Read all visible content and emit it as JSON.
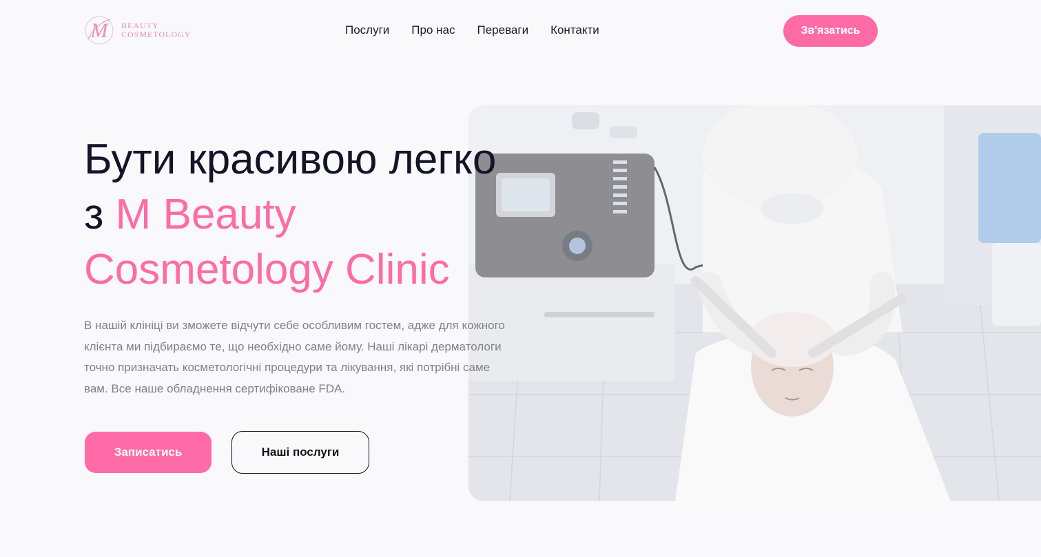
{
  "header": {
    "logo": {
      "line1": "BEAUTY",
      "line2": "COSMETOLOGY",
      "monogram": "M"
    },
    "nav": [
      {
        "label": "Послуги"
      },
      {
        "label": "Про нас"
      },
      {
        "label": "Переваги"
      },
      {
        "label": "Контакти"
      }
    ],
    "contact_button": "Зв'язатись"
  },
  "hero": {
    "title_line1": "Бути красивою легко",
    "title_prefix": "з ",
    "title_brand_line1": "M Beauty",
    "title_brand_line2": "Cosmetology Clinic",
    "description": "В нашій клініці ви зможете відчути себе особливим гостем, адже для кожного клієнта ми підбираємо те, що необхідно саме йому. Наші лікарі дерматологи точно призначать косметологічні процедури та лікування, які потрібні саме вам. Все наше обладнення сертифіковане FDA.",
    "primary_button": "Записатись",
    "secondary_button": "Наші послуги"
  },
  "colors": {
    "accent": "#ff6ba6",
    "text_dark": "#141428",
    "text_muted": "#80808f",
    "background": "#f9f9fb"
  },
  "icons": {
    "logo": "m-monogram-logo",
    "hero_photo": "cosmetology-procedure-photo"
  }
}
